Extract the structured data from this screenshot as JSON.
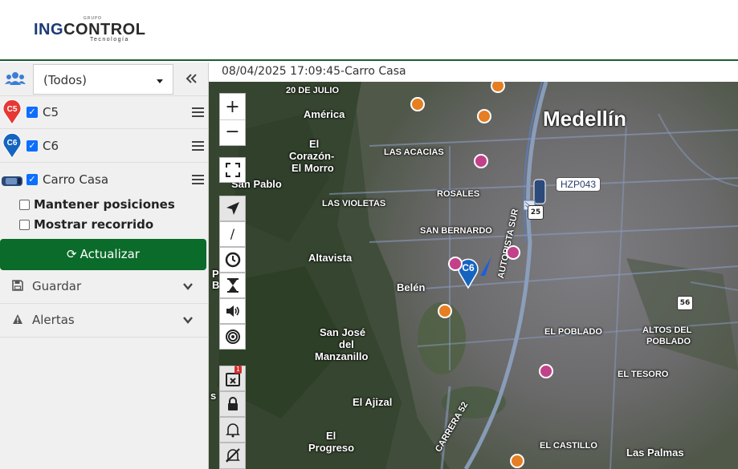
{
  "header": {
    "logo_text_a": "ING",
    "logo_text_b": "CONTROL",
    "logo_sub": "Tecnología",
    "logo_top": "GRUPO"
  },
  "sidebar": {
    "group_select": "(Todos)",
    "vehicles": [
      {
        "marker": "C5",
        "name": "C5",
        "checked": true,
        "color": "#e53935"
      },
      {
        "marker": "C6",
        "name": "C6",
        "checked": true,
        "color": "#1565c0"
      },
      {
        "marker": "car",
        "name": "Carro Casa",
        "checked": true,
        "color": "#2b4a7a"
      }
    ],
    "options": [
      {
        "label": "Mantener posiciones",
        "checked": false
      },
      {
        "label": "Mostrar recorrido",
        "checked": false
      }
    ],
    "refresh_label": "Actualizar",
    "accordions": [
      {
        "label": "Guardar",
        "icon": "save-icon"
      },
      {
        "label": "Alertas",
        "icon": "warning-icon"
      }
    ]
  },
  "map": {
    "title": "08/04/2025 17:09:45-Carro Casa",
    "plate": "HZP043",
    "vehicle_marker": "C6",
    "alert_badge": "1",
    "places": [
      {
        "t": "20 DE JULIO",
        "c": "sm"
      },
      {
        "t": "América",
        "c": "md"
      },
      {
        "t": "Medellín",
        "c": "lg"
      },
      {
        "t": "El",
        "c": "md"
      },
      {
        "t": "Corazón-",
        "c": "md"
      },
      {
        "t": "El Morro",
        "c": "md"
      },
      {
        "t": "LAS ACACIAS",
        "c": "sm"
      },
      {
        "t": "San Pablo",
        "c": "md"
      },
      {
        "t": "ROSALES",
        "c": "sm"
      },
      {
        "t": "LAS VIOLETAS",
        "c": "sm"
      },
      {
        "t": "SAN BERNARDO",
        "c": "sm"
      },
      {
        "t": "Altavista",
        "c": "md"
      },
      {
        "t": "Belén",
        "c": "md"
      },
      {
        "t": "AUTOPISTA SUR",
        "c": "sm"
      },
      {
        "t": "EL POBLADO",
        "c": "sm"
      },
      {
        "t": "ALTOS DEL",
        "c": "sm"
      },
      {
        "t": "POBLADO",
        "c": "sm"
      },
      {
        "t": "San José",
        "c": "md"
      },
      {
        "t": "del",
        "c": "md"
      },
      {
        "t": "Manzanillo",
        "c": "md"
      },
      {
        "t": "EL TESORO",
        "c": "sm"
      },
      {
        "t": "El Ajizal",
        "c": "md"
      },
      {
        "t": "CARRERA 52",
        "c": "sm"
      },
      {
        "t": "El",
        "c": "md"
      },
      {
        "t": "Progreso",
        "c": "md"
      },
      {
        "t": "EL CASTILLO",
        "c": "sm"
      },
      {
        "t": "Las Palmas",
        "c": "md"
      },
      {
        "t": "P",
        "c": "md"
      },
      {
        "t": "B",
        "c": "md"
      },
      {
        "t": "s",
        "c": "md"
      }
    ],
    "shields": [
      "25",
      "56"
    ],
    "controls": {
      "zoom_in": "+",
      "zoom_out": "−",
      "line_tool": "/"
    }
  }
}
